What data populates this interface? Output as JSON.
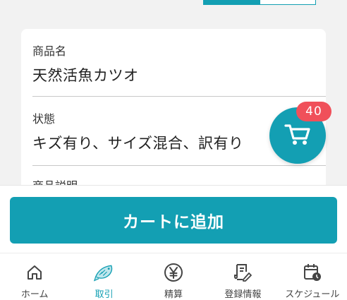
{
  "product": {
    "name_label": "商品名",
    "name_value": "天然活魚カツオ",
    "condition_label": "状態",
    "condition_value": "キズ有り、サイズ混合、訳有り",
    "description_label": "商品説明"
  },
  "cart": {
    "badge_count": "40",
    "add_button_label": "カートに追加"
  },
  "tabs": [
    {
      "label": "ホーム",
      "icon": "home-icon"
    },
    {
      "label": "取引",
      "icon": "fish-icon",
      "active": true
    },
    {
      "label": "精算",
      "icon": "yen-icon"
    },
    {
      "label": "登録情報",
      "icon": "registration-icon"
    },
    {
      "label": "スケジュール",
      "icon": "calendar-icon"
    }
  ],
  "colors": {
    "accent": "#139fb3",
    "badge": "#f0505a",
    "background": "#f2f2f2"
  }
}
